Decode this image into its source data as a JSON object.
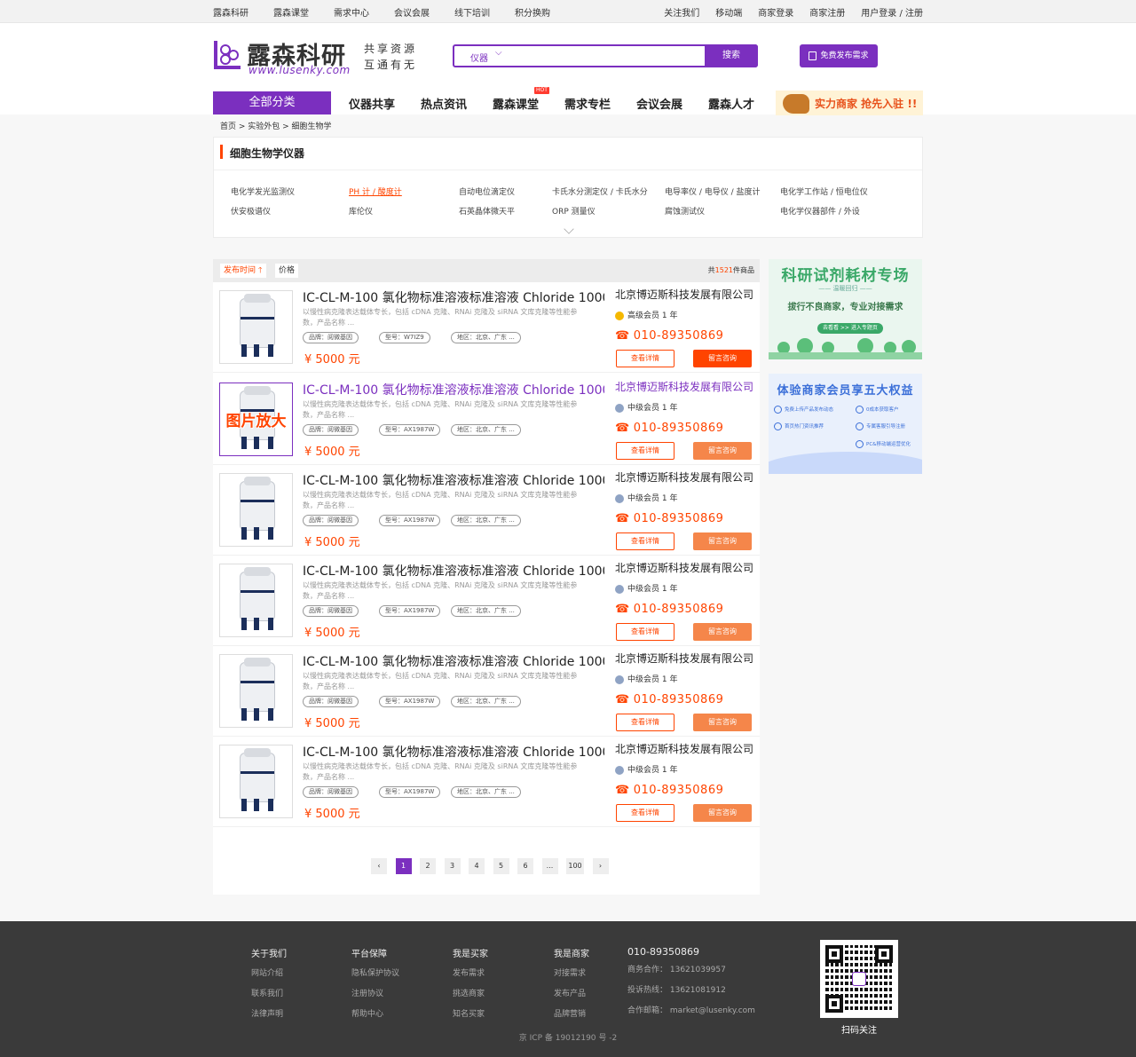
{
  "topbar": {
    "left": [
      "露森科研",
      "露森课堂",
      "需求中心",
      "会议会展",
      "线下培训",
      "积分换购"
    ],
    "right": [
      "关注我们",
      "移动端",
      "商家登录",
      "商家注册",
      "用户登录 / 注册"
    ]
  },
  "header": {
    "logo_name": "露森科研",
    "logo_url": "www.lusenky.com",
    "slogan1": "共享资源",
    "slogan2": "互通有无",
    "search_category": "仪器",
    "search_button": "搜索",
    "publish_button": "免费发布需求"
  },
  "nav": {
    "all": "全部分类",
    "items": [
      "仪器共享",
      "热点资讯",
      "露森课堂",
      "需求专栏",
      "会议会展",
      "露森人才"
    ],
    "hot_badge": "HOT",
    "promo": "实力商家  抢先入驻 !!"
  },
  "breadcrumb": "首页 > 实验外包 > 细胞生物学",
  "category_panel": {
    "title": "细胞生物学仪器",
    "row1": [
      "电化学发光监测仪",
      "PH 计 / 酸度计",
      "自动电位滴定仪",
      "卡氏水分测定仪 / 卡氏水分",
      "电导率仪 / 电导仪 / 盐度计",
      "电化学工作站 / 恒电位仪"
    ],
    "row2": [
      "伏安极谱仪",
      "库伦仪",
      "石英晶体微天平",
      "ORP 测量仪",
      "腐蚀测试仪",
      "电化学仪器部件 / 外设"
    ]
  },
  "sort": {
    "time": "发布时间",
    "price": "价格",
    "count_prefix": "共",
    "count": "1521",
    "count_suffix": "件商品"
  },
  "products": [
    {
      "title": "IC-CL-M-100 氯化物标准溶液标准溶液 Chloride 1000...",
      "desc": "以慢性病克隆表达载体专长，包括 cDNA 克隆、RNAi 克隆及 siRNA 文库克隆等性能参数，产品名称 ...",
      "brand": "品牌：阅微基因",
      "model": "型号：W7IZ9",
      "region": "地区：北京、广东 ...",
      "price": "¥ 5000 元",
      "company": "北京博迈斯科技发展有限公司",
      "level": "高级会员  1 年",
      "phone": "010-89350869",
      "detail": "查看详情",
      "consult": "留言咨询"
    },
    {
      "title": "IC-CL-M-100 氯化物标准溶液标准溶液 Chloride 1000...",
      "desc": "以慢性病克隆表达载体专长，包括 cDNA 克隆、RNAi 克隆及 siRNA 文库克隆等性能参数，产品名称 ...",
      "brand": "品牌：阅微基因",
      "model": "型号：AX1987W",
      "region": "地区：北京、广东 ...",
      "price": "¥ 5000 元",
      "company": "北京博迈斯科技发展有限公司",
      "level": "中级会员  1 年",
      "phone": "010-89350869",
      "detail": "查看详情",
      "consult": "留言咨询",
      "overlay": "图片放大"
    },
    {
      "title": "IC-CL-M-100 氯化物标准溶液标准溶液 Chloride 1000...",
      "desc": "以慢性病克隆表达载体专长，包括 cDNA 克隆、RNAi 克隆及 siRNA 文库克隆等性能参数，产品名称 ...",
      "brand": "品牌：阅微基因",
      "model": "型号：AX1987W",
      "region": "地区：北京、广东 ...",
      "price": "¥ 5000 元",
      "company": "北京博迈斯科技发展有限公司",
      "level": "中级会员  1 年",
      "phone": "010-89350869",
      "detail": "查看详情",
      "consult": "留言咨询"
    },
    {
      "title": "IC-CL-M-100 氯化物标准溶液标准溶液 Chloride 1000...",
      "desc": "以慢性病克隆表达载体专长，包括 cDNA 克隆、RNAi 克隆及 siRNA 文库克隆等性能参数，产品名称 ...",
      "brand": "品牌：阅微基因",
      "model": "型号：AX1987W",
      "region": "地区：北京、广东 ...",
      "price": "¥ 5000 元",
      "company": "北京博迈斯科技发展有限公司",
      "level": "中级会员  1 年",
      "phone": "010-89350869",
      "detail": "查看详情",
      "consult": "留言咨询"
    },
    {
      "title": "IC-CL-M-100 氯化物标准溶液标准溶液 Chloride 1000...",
      "desc": "以慢性病克隆表达载体专长，包括 cDNA 克隆、RNAi 克隆及 siRNA 文库克隆等性能参数，产品名称 ...",
      "brand": "品牌：阅微基因",
      "model": "型号：AX1987W",
      "region": "地区：北京、广东 ...",
      "price": "¥ 5000 元",
      "company": "北京博迈斯科技发展有限公司",
      "level": "中级会员  1 年",
      "phone": "010-89350869",
      "detail": "查看详情",
      "consult": "留言咨询"
    },
    {
      "title": "IC-CL-M-100 氯化物标准溶液标准溶液 Chloride 1000...",
      "desc": "以慢性病克隆表达载体专长，包括 cDNA 克隆、RNAi 克隆及 siRNA 文库克隆等性能参数，产品名称 ...",
      "brand": "品牌：阅微基因",
      "model": "型号：AX1987W",
      "region": "地区：北京、广东 ...",
      "price": "¥ 5000 元",
      "company": "北京博迈斯科技发展有限公司",
      "level": "中级会员  1 年",
      "phone": "010-89350869",
      "detail": "查看详情",
      "consult": "留言咨询"
    }
  ],
  "pagination": [
    "1",
    "2",
    "3",
    "4",
    "5",
    "6",
    "...",
    "100"
  ],
  "banner1": {
    "title": "科研试剂耗材专场",
    "sub": "—— 温暖回归 ——",
    "line": "拔行不良商家，专业对接需求",
    "button": "去看看 >> 进入专题页"
  },
  "banner2": {
    "title": "体验商家会员享五大权益",
    "items": [
      "免费上传产品发布动态",
      "0成本获取客户",
      "首页热门资讯推荐",
      "专属客服引导注册",
      "PC&移动端运营优化"
    ]
  },
  "footer": {
    "cols": [
      {
        "title": "关于我们",
        "links": [
          "网站介绍",
          "联系我们",
          "法律声明"
        ]
      },
      {
        "title": "平台保障",
        "links": [
          "隐私保护协议",
          "注册协议",
          "帮助中心"
        ]
      },
      {
        "title": "我是买家",
        "links": [
          "发布需求",
          "挑选商家",
          "知名买家"
        ]
      },
      {
        "title": "我是商家",
        "links": [
          "对接需求",
          "发布产品",
          "品牌营销"
        ]
      }
    ],
    "phone": "010-89350869",
    "contacts": [
      "商务合作：  13621039957",
      "投诉热线：  13621081912",
      "合作邮箱：  market@lusenky.com"
    ],
    "qr_label": "扫码关注",
    "icp": "京 ICP 备 19012190 号 -2"
  },
  "colors": {
    "brand": "#7b2fbf",
    "accent": "#ff4400",
    "consult": "#f5864a"
  }
}
